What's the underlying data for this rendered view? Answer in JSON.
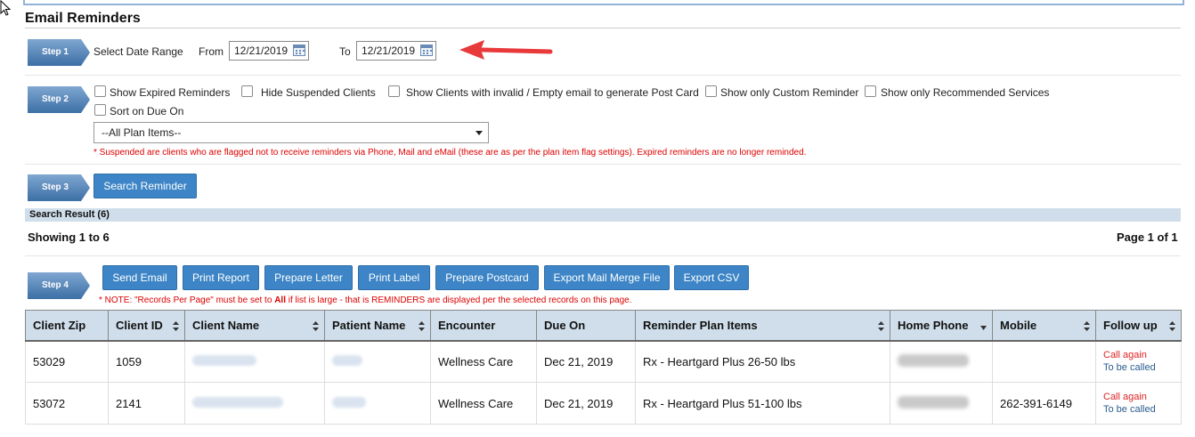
{
  "page": {
    "title": "Email Reminders"
  },
  "steps": {
    "s1": "Step 1",
    "s2": "Step 2",
    "s3": "Step 3",
    "s4": "Step 4"
  },
  "step1": {
    "label": "Select Date Range",
    "from_label": "From",
    "from_value": "12/21/2019",
    "to_label": "To",
    "to_value": "12/21/2019"
  },
  "step2": {
    "checkboxes": [
      "Show Expired Reminders",
      "Hide Suspended Clients",
      "Show Clients with invalid / Empty email to generate Post Card",
      "Show only Custom Reminder",
      "Show only Recommended Services",
      "Sort on Due On"
    ],
    "plan_select": "--All Plan Items--",
    "note": "* Suspended are clients who are flagged not to receive reminders via Phone, Mail and eMail (these are as per the plan item flag settings). Expired reminders are no longer reminded."
  },
  "step3": {
    "search_button": "Search Reminder"
  },
  "results": {
    "title": "Search Result (6)",
    "showing": "Showing 1 to 6",
    "page": "Page 1 of 1"
  },
  "step4": {
    "buttons": [
      "Send Email",
      "Print Report",
      "Prepare Letter",
      "Print Label",
      "Prepare Postcard",
      "Export Mail Merge File",
      "Export CSV"
    ],
    "note_prefix": "* NOTE: \"Records Per Page\" must be set to ",
    "note_bold": "All",
    "note_suffix": " if list is large - that is REMINDERS are displayed per the selected records on this page."
  },
  "table": {
    "columns": [
      "Client Zip",
      "Client ID",
      "Client Name",
      "Patient Name",
      "Encounter",
      "Due On",
      "Reminder Plan Items",
      "Home Phone",
      "Mobile",
      "Follow up"
    ],
    "rows": [
      {
        "zip": "53029",
        "id": "1059",
        "encounter": "Wellness Care",
        "due": "Dec 21, 2019",
        "plan": "Rx - Heartgard Plus 26-50 lbs",
        "mobile": "",
        "fu1": "Call again",
        "fu2": "To be called"
      },
      {
        "zip": "53072",
        "id": "2141",
        "encounter": "Wellness Care",
        "due": "Dec 21, 2019",
        "plan": "Rx - Heartgard Plus 51-100 lbs",
        "mobile": "262-391-6149",
        "fu1": "Call again",
        "fu2": "To be called"
      }
    ]
  },
  "colors": {
    "button": "#3d85c6",
    "header_bg": "#cfdeea",
    "note_red": "#dd0000",
    "arrow": "#e8393b"
  }
}
